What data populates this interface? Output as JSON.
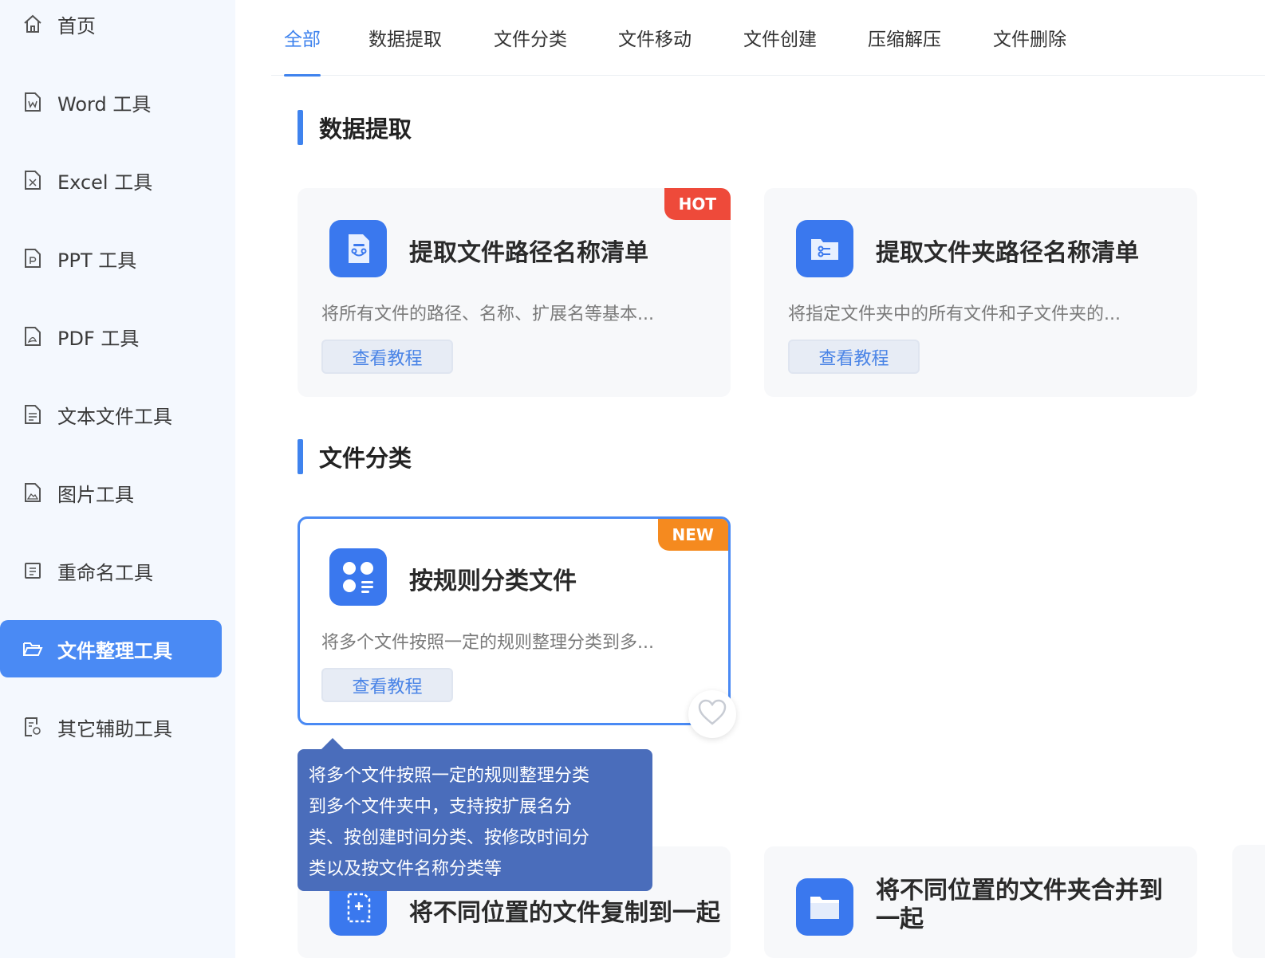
{
  "sidebar": {
    "items": [
      {
        "label": "首页",
        "icon": "home-icon"
      },
      {
        "label": "Word 工具",
        "icon": "word-doc-icon"
      },
      {
        "label": "Excel 工具",
        "icon": "excel-doc-icon"
      },
      {
        "label": "PPT 工具",
        "icon": "ppt-doc-icon"
      },
      {
        "label": "PDF 工具",
        "icon": "pdf-doc-icon"
      },
      {
        "label": "文本文件工具",
        "icon": "text-doc-icon"
      },
      {
        "label": "图片工具",
        "icon": "image-doc-icon"
      },
      {
        "label": "重命名工具",
        "icon": "rename-icon"
      },
      {
        "label": "文件整理工具",
        "icon": "folder-open-icon",
        "active": true
      },
      {
        "label": "其它辅助工具",
        "icon": "tools-doc-icon"
      }
    ]
  },
  "tabs": [
    {
      "label": "全部",
      "active": true
    },
    {
      "label": "数据提取"
    },
    {
      "label": "文件分类"
    },
    {
      "label": "文件移动"
    },
    {
      "label": "文件创建"
    },
    {
      "label": "压缩解压"
    },
    {
      "label": "文件删除"
    }
  ],
  "sections": {
    "data_extract": {
      "title": "数据提取",
      "cards": [
        {
          "title": "提取文件路径名称清单",
          "desc": "将所有文件的路径、名称、扩展名等基本...",
          "button": "查看教程",
          "badge": "HOT",
          "icon": "file-list-icon"
        },
        {
          "title": "提取文件夹路径名称清单",
          "desc": "将指定文件夹中的所有文件和子文件夹的...",
          "button": "查看教程",
          "icon": "folder-list-icon"
        }
      ]
    },
    "file_classify": {
      "title": "文件分类",
      "cards": [
        {
          "title": "按规则分类文件",
          "desc": "将多个文件按照一定的规则整理分类到多...",
          "button": "查看教程",
          "badge": "NEW",
          "icon": "classify-grid-icon"
        }
      ]
    },
    "bottom": {
      "cards": [
        {
          "title": "将不同位置的文件复制到一起",
          "icon": "copy-file-icon"
        },
        {
          "title": "将不同位置的文件夹合并到一起",
          "icon": "merge-folder-icon"
        }
      ]
    }
  },
  "tooltip": {
    "lines": [
      "将多个文件按照一定的规则整理分类",
      "到多个文件夹中，支持按扩展名分",
      "类、按创建时间分类、按修改时间分",
      "类以及按文件名称分类等"
    ]
  },
  "colors": {
    "accent": "#3f83ee",
    "sidebar_active": "#4a8af4",
    "hot": "#ee4a3a",
    "new": "#f58a1f",
    "tooltip": "#4a6dbb"
  }
}
